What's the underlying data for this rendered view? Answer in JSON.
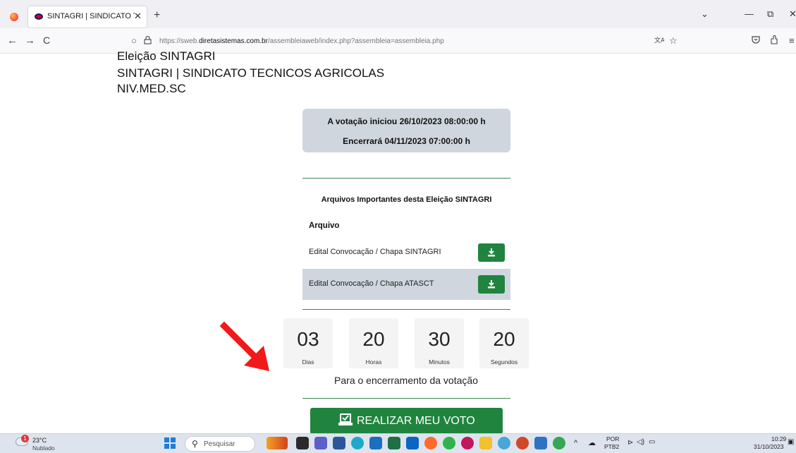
{
  "browser": {
    "tab_title": "SINTAGRI | SINDICATO TECNIC",
    "tab_close": "✕",
    "new_tab": "+",
    "url_prefix": "https://sweb.",
    "url_domain": "diretasistemas.com.br",
    "url_path": "/assembleiaweb/index.php?assembleia=assembleia.php",
    "back": "←",
    "forward": "→",
    "reload": "C",
    "min": "—",
    "restore": "⧉",
    "close": "✕",
    "tab_list": "⌄"
  },
  "header": {
    "line1": "Eleição SINTAGRI",
    "line2": "SINTAGRI | SINDICATO TECNICOS AGRICOLAS",
    "line3": "NIV.MED.SC"
  },
  "dates": {
    "start": "A votação iniciou 26/10/2023 08:00:00 h",
    "end": "Encerrará 04/11/2023 07:00:00 h"
  },
  "files": {
    "title": "Arquivos Importantes desta Eleição SINTAGRI",
    "column": "Arquivo",
    "rows": [
      {
        "name": "Edital Convocação / Chapa SINTAGRI"
      },
      {
        "name": "Edital Convocação / Chapa ATASCT"
      }
    ]
  },
  "countdown": {
    "units": [
      {
        "value": "03",
        "label": "Dias"
      },
      {
        "value": "20",
        "label": "Horas"
      },
      {
        "value": "30",
        "label": "Minutos"
      },
      {
        "value": "20",
        "label": "Segundos"
      }
    ],
    "caption": "Para o encerramento da votação"
  },
  "vote_button": "REALIZAR MEU VOTO",
  "annotation": {
    "arrow_color": "#f01a1a"
  },
  "colors": {
    "accent": "#20843f",
    "panel": "#cfd6dd"
  },
  "taskbar": {
    "temperature": "23°C",
    "condition": "Nublado",
    "weather_badge": "1",
    "search_placeholder": "Pesquisar",
    "lang_top": "POR",
    "lang_bottom": "PTB2",
    "time": "10:29",
    "date": "31/10/2023"
  }
}
